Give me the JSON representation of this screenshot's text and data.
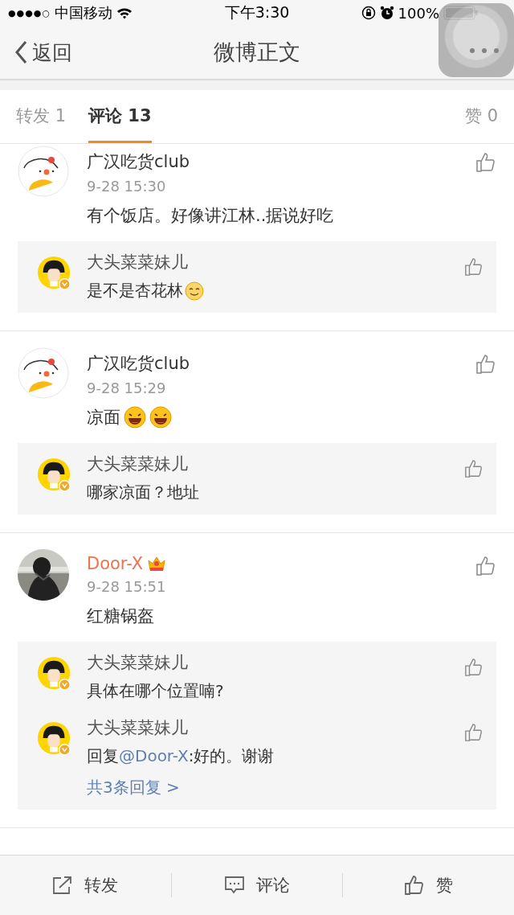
{
  "status_bar": {
    "signal_dots": "●●●●○",
    "carrier": "中国移动",
    "time": "下午3:30",
    "battery": "100%"
  },
  "nav": {
    "back": "返回",
    "title": "微博正文"
  },
  "tabs": [
    {
      "label": "转发 1",
      "selected": false
    },
    {
      "label": "评论 13",
      "selected": true
    },
    {
      "label": "赞 0",
      "selected": false
    }
  ],
  "comments": [
    {
      "user": "广汉吃货club",
      "vip": false,
      "avatar": {
        "kind": "chicken"
      },
      "time": "9-28 15:30",
      "text": "有个饭店。好像讲江林..据说好吃",
      "replies": [
        {
          "user": "大头菜菜妹儿",
          "avatar": {
            "kind": "girl"
          },
          "verified": true,
          "parts": [
            {
              "kind": "text",
              "text": "是不是杏花林"
            }
          ],
          "emojis": [
            {
              "kind": "smile"
            }
          ]
        }
      ]
    },
    {
      "user": "广汉吃货club",
      "vip": false,
      "avatar": {
        "kind": "chicken"
      },
      "time": "9-28 15:29",
      "text": "凉面",
      "emojis": [
        {
          "kind": "laugh"
        },
        {
          "kind": "laugh"
        }
      ],
      "replies": [
        {
          "user": "大头菜菜妹儿",
          "avatar": {
            "kind": "girl"
          },
          "verified": true,
          "parts": [
            {
              "kind": "text",
              "text": "哪家凉面？地址"
            }
          ]
        }
      ]
    },
    {
      "user": "Door-X",
      "vip": true,
      "avatar": {
        "kind": "picture"
      },
      "time": "9-28 15:51",
      "text": "红糖锅盔",
      "replies": [
        {
          "user": "大头菜菜妹儿",
          "avatar": {
            "kind": "girl"
          },
          "verified": true,
          "parts": [
            {
              "kind": "text",
              "text": "具体在哪个位置喃?"
            }
          ]
        },
        {
          "user": "大头菜菜妹儿",
          "avatar": {
            "kind": "girl"
          },
          "verified": true,
          "parts": [
            {
              "kind": "text",
              "text": "回复"
            },
            {
              "kind": "mention",
              "text": "@Door-X"
            },
            {
              "kind": "text",
              "text": ":好的。谢谢"
            }
          ]
        }
      ],
      "more_replies": "共3条回复 >"
    }
  ],
  "bottom_bar": [
    {
      "kind": "repost",
      "label": "转发"
    },
    {
      "kind": "comment",
      "label": "评论"
    },
    {
      "kind": "like",
      "label": "赞"
    }
  ]
}
